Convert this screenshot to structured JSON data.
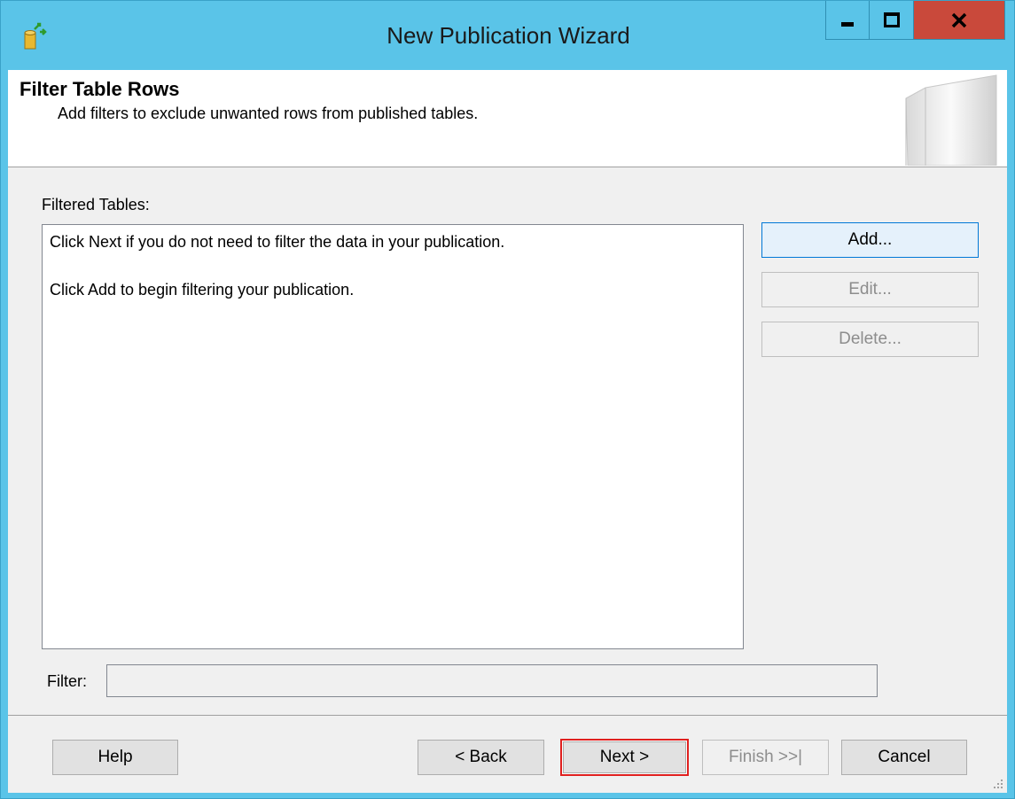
{
  "window": {
    "title": "New Publication Wizard",
    "colors": {
      "titlebar": "#5ac4e8",
      "close": "#c9493b",
      "highlight": "#e0201f"
    }
  },
  "header": {
    "title": "Filter Table Rows",
    "subtitle": "Add filters to exclude unwanted rows from published tables."
  },
  "main": {
    "filtered_tables_label": "Filtered Tables:",
    "list_lines": [
      "Click Next if you do not need to filter the data in your publication.",
      "Click Add to begin filtering your publication."
    ],
    "buttons": {
      "add": "Add...",
      "edit": "Edit...",
      "delete": "Delete..."
    },
    "filter_label": "Filter:",
    "filter_value": ""
  },
  "footer": {
    "help": "Help",
    "back": "< Back",
    "next": "Next >",
    "finish": "Finish >>|",
    "cancel": "Cancel"
  }
}
